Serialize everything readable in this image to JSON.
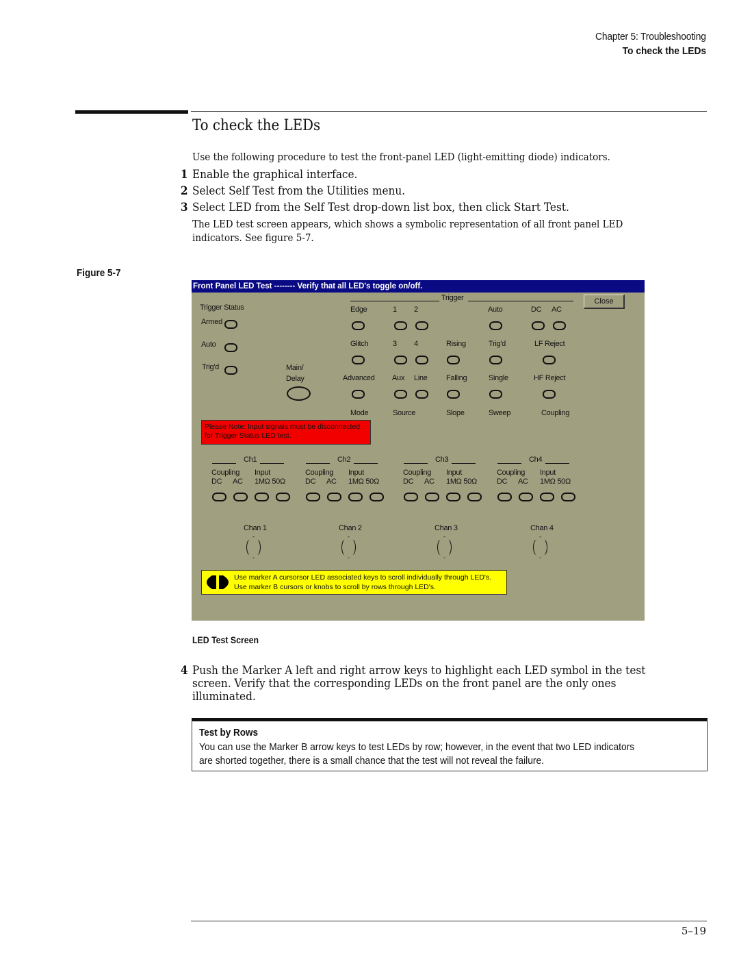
{
  "header": {
    "chapter": "Chapter 5: Troubleshooting",
    "section": "To check the LEDs"
  },
  "section_title": "To check the LEDs",
  "intro": "Use the following procedure to test the front-panel LED (light-emitting diode) indicators.",
  "steps": [
    {
      "num": "1",
      "text": "Enable the graphical interface."
    },
    {
      "num": "2",
      "text": "Select Self Test from the Utilities menu."
    },
    {
      "num": "3",
      "text": "Select LED from the Self Test drop-down list box, then click Start Test."
    },
    {
      "num": "4",
      "lines": [
        "Push the Marker A left and right arrow keys to highlight each LED symbol in the test",
        "screen. Verify that the corresponding LEDs on the front panel are the only ones",
        "illuminated."
      ]
    }
  ],
  "step3_detail": [
    "The LED test screen appears, which shows a symbolic representation of all front panel LED",
    "indicators. See figure 5-7."
  ],
  "figure": {
    "label": "Figure 5-7",
    "caption": "LED Test Screen"
  },
  "dialog": {
    "title": "Front Panel LED Test -------- Verify that all LED's toggle on/off.",
    "close_label": "Close",
    "trigger_status": {
      "heading": "Trigger Status",
      "leds": [
        "Armed",
        "Auto",
        "Trig'd"
      ]
    },
    "main_delay": [
      "Main/",
      "Delay"
    ],
    "trigger_heading": "Trigger",
    "trigger_labels": {
      "row1": [
        "Edge",
        "1",
        "2",
        "Auto",
        "DC",
        "AC"
      ],
      "row2": [
        "Glitch",
        "3",
        "4",
        "Rising",
        "Trig'd",
        "LF Reject"
      ],
      "row3": [
        "Advanced",
        "Aux",
        "Line",
        "Falling",
        "Single",
        "HF Reject"
      ],
      "groups": [
        "Mode",
        "Source",
        "Slope",
        "Sweep",
        "Coupling"
      ]
    },
    "red_note": [
      "Please Note: Input signals must be disconnected",
      "for Trigger Status LED test."
    ],
    "channels": [
      {
        "name": "Ch1",
        "chan": "Chan 1"
      },
      {
        "name": "Ch2",
        "chan": "Chan 2"
      },
      {
        "name": "Ch3",
        "chan": "Chan 3"
      },
      {
        "name": "Ch4",
        "chan": "Chan 4"
      }
    ],
    "channel_labels": {
      "coupling": "Coupling",
      "input": "Input",
      "dc": "DC",
      "ac": "AC",
      "imp": "1MΩ 50Ω"
    },
    "yellow_note": [
      "Use marker A cursorsor LED associated keys to scroll individually through LED's.",
      "Use marker B cursors or knobs to scroll by rows through LED's."
    ],
    "colors": {
      "panel": "#a09f80",
      "titlebar": "#0a0a84",
      "warning_red": "#f20000",
      "hint_yellow": "#ffff00"
    }
  },
  "note": {
    "title": "Test by Rows",
    "lines": [
      "You can use the Marker B arrow keys to test LEDs by row; however, in the event that two LED indicators",
      "are shorted together, there is a small chance that the test will not reveal the failure."
    ]
  },
  "page_number": "5–19"
}
